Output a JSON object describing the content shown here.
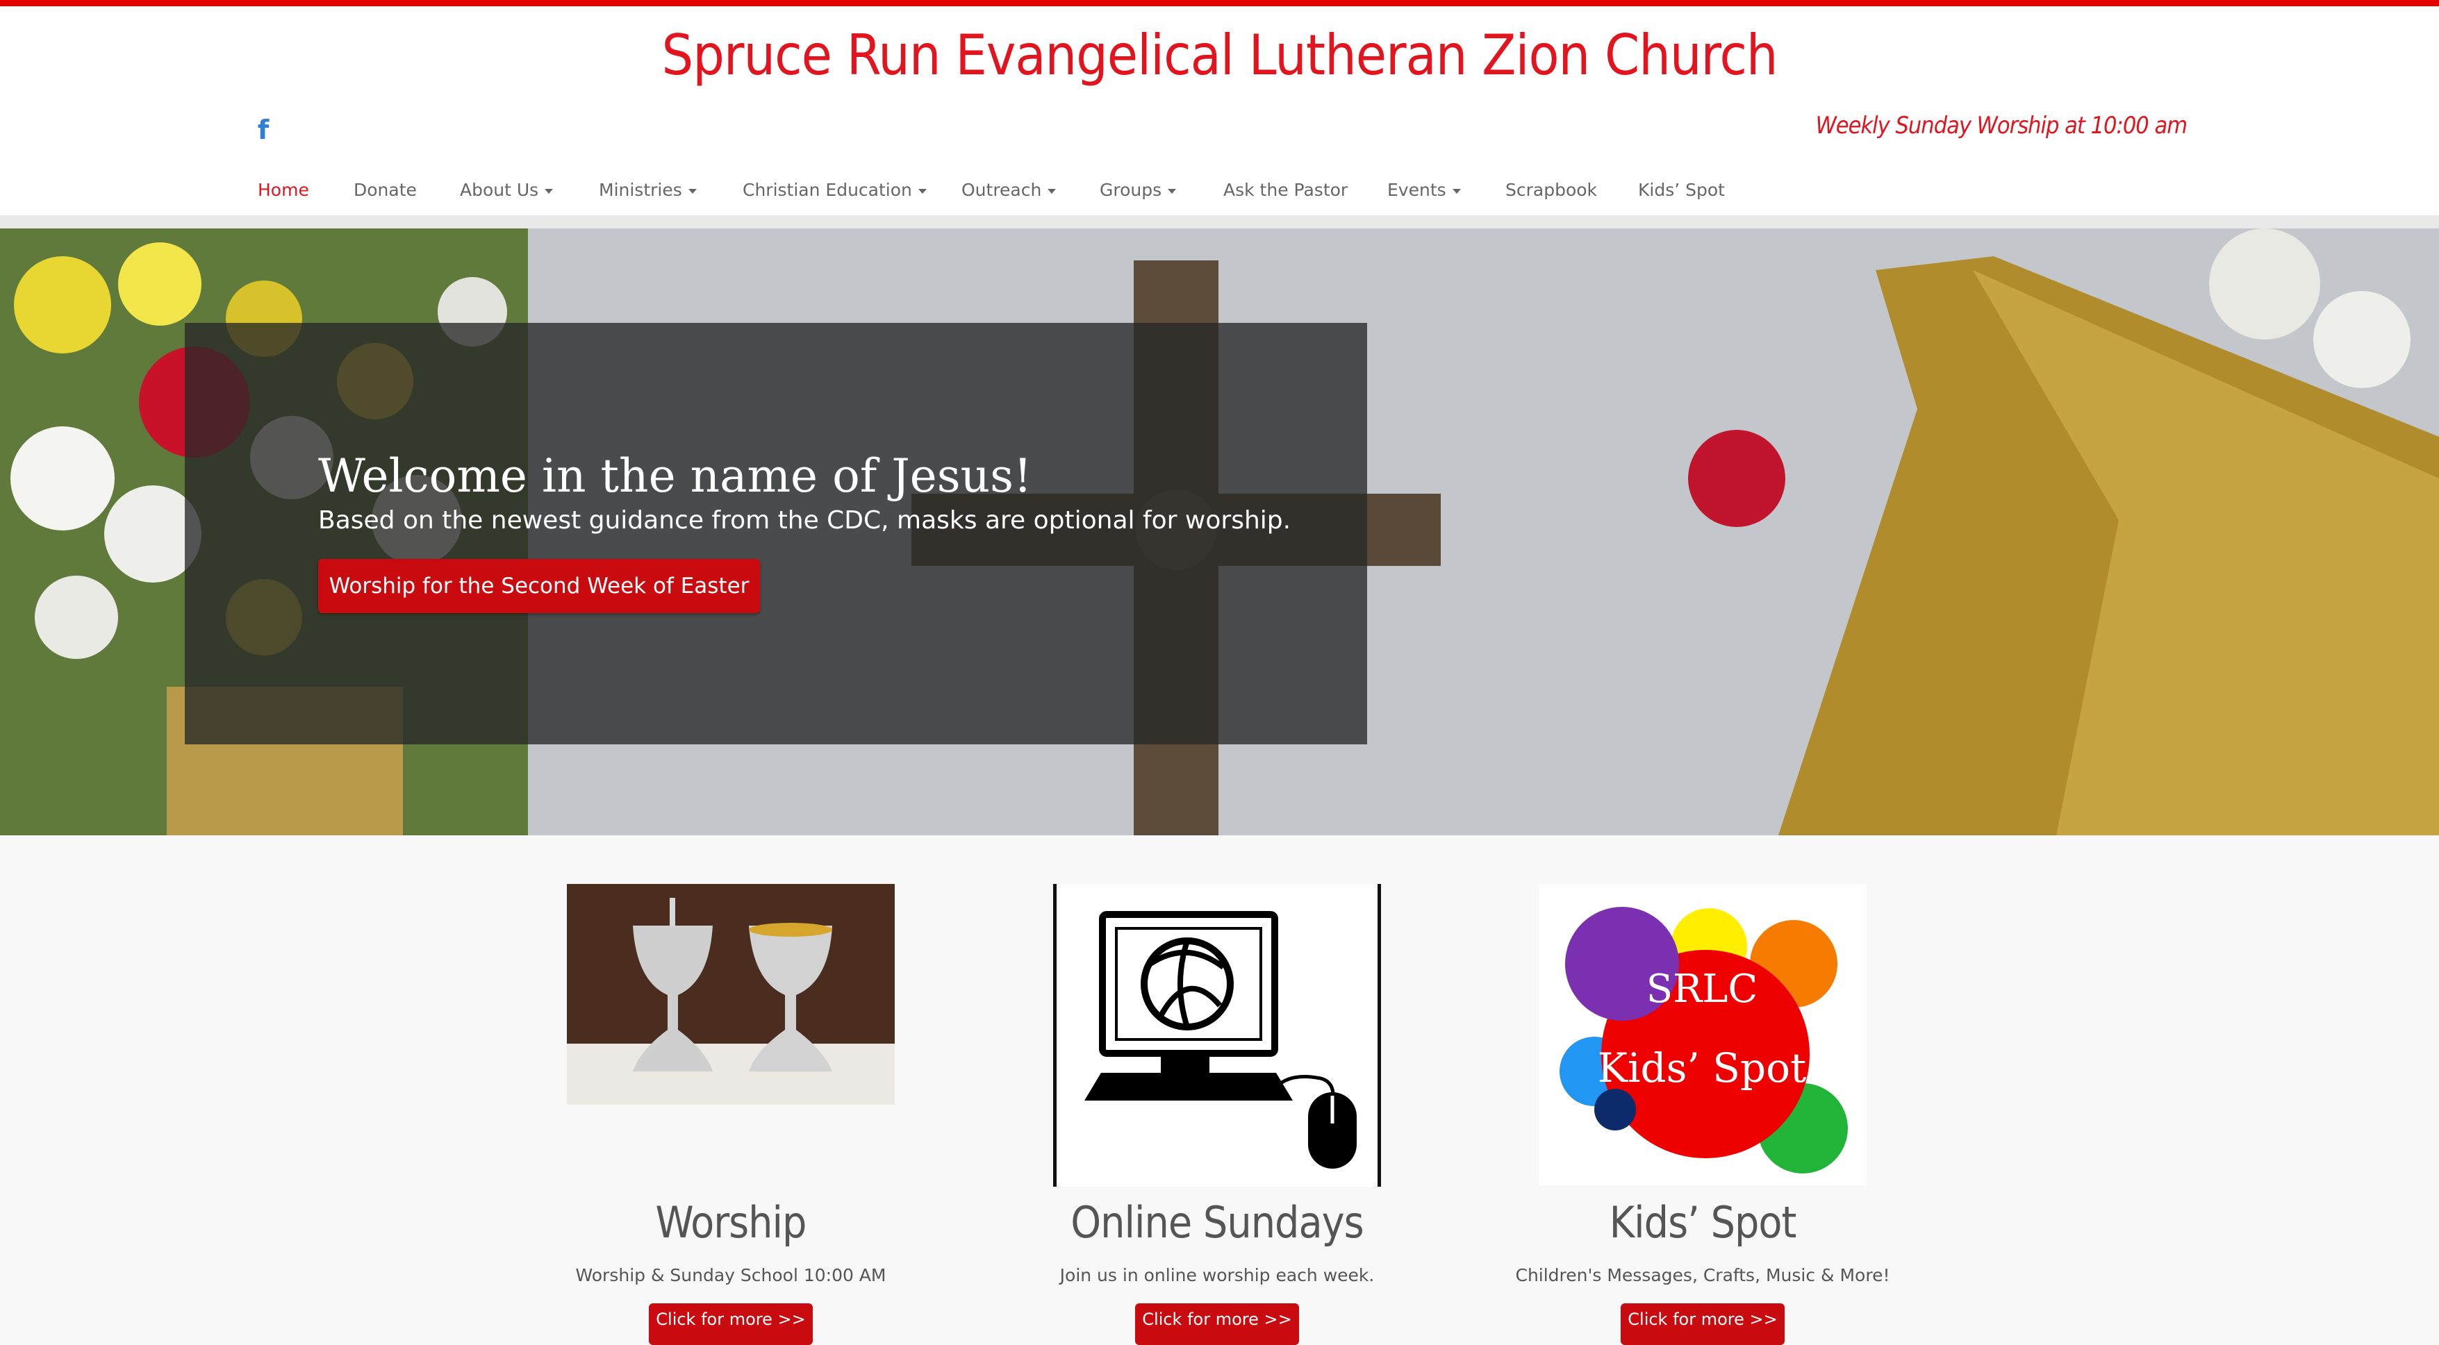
{
  "header": {
    "site_title": "Spruce Run Evangelical Lutheran Zion Church",
    "tagline": "Weekly Sunday Worship at 10:00 am",
    "social_icon": "facebook-icon",
    "accent_color": "#e2141e"
  },
  "nav": {
    "items": [
      {
        "label": "Home",
        "active": true,
        "dropdown": false
      },
      {
        "label": "Donate",
        "dropdown": false
      },
      {
        "label": "About Us",
        "dropdown": true
      },
      {
        "label": "Ministries",
        "dropdown": true
      },
      {
        "label": "Christian Education",
        "dropdown": true
      },
      {
        "label": "Outreach",
        "dropdown": true
      },
      {
        "label": "Groups",
        "dropdown": true
      },
      {
        "label": "Ask the Pastor",
        "dropdown": false
      },
      {
        "label": "Events",
        "dropdown": true
      },
      {
        "label": "Scrapbook",
        "dropdown": false
      },
      {
        "label": "Kids’ Spot",
        "dropdown": false
      }
    ]
  },
  "hero": {
    "heading": "Welcome in the name of Jesus!",
    "subtext": "Based on the newest guidance from the CDC, masks are optional for worship.",
    "button_label": "Worship for the Second Week of Easter",
    "button_color": "#c90b10"
  },
  "features": [
    {
      "title": "Worship",
      "text": "Worship & Sunday School 10:00 AM",
      "button_label": "Click for more >>",
      "image": "chalice-photo"
    },
    {
      "title": "Online Sundays",
      "text": "Join us in online worship each week.",
      "button_label": "Click for more >>",
      "image": "computer-mouse-icon"
    },
    {
      "title": "Kids’ Spot",
      "text": "Children's Messages, Crafts, Music & More!",
      "button_label": "Click for more >>",
      "image": "kids-spot-logo",
      "logo_text_line1": "SRLC",
      "logo_text_line2": "Kids’ Spot"
    }
  ]
}
